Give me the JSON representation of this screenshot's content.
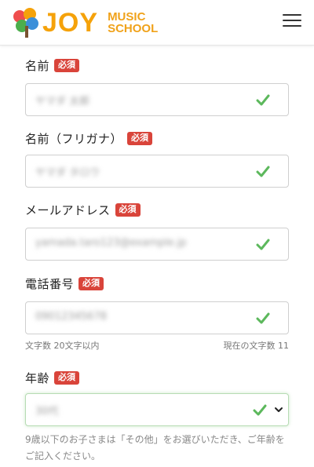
{
  "header": {
    "logo_main": "JOY",
    "logo_sub_1": "MUSIC",
    "logo_sub_2": "SCHOOL"
  },
  "required_badge": "必須",
  "fields": {
    "name": {
      "label": "名前",
      "value": "ヤマダ 太郎"
    },
    "kana": {
      "label": "名前（フリガナ）",
      "value": "ヤマダ タロウ"
    },
    "email": {
      "label": "メールアドレス",
      "value": "yamada.taro123@example.jp"
    },
    "phone": {
      "label": "電話番号",
      "value": "09012345678",
      "help_left": "文字数 20文字以内",
      "help_right": "現在の文字数 11"
    },
    "age": {
      "label": "年齢",
      "value": "30代",
      "note": "9歳以下のお子さまは「その他」をお選びいただき、ご年齢をご記入ください。"
    }
  },
  "colors": {
    "accent": "#f5a20a",
    "badge": "#d9443a",
    "check": "#5cb85c"
  },
  "icons": {
    "menu": "hamburger-menu-icon",
    "check": "check-icon",
    "chevron": "chevron-down-icon"
  }
}
